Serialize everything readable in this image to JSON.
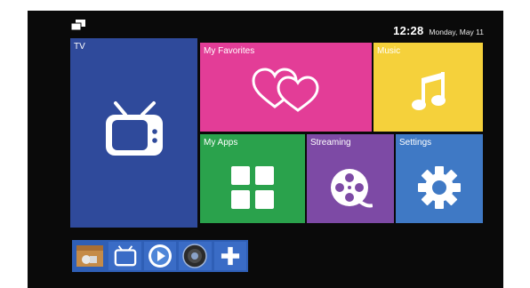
{
  "status": {
    "time": "12:28",
    "date": "Monday, May 11"
  },
  "tiles": {
    "tv": {
      "label": "TV",
      "color": "#2f4a9b",
      "icon": "tv-icon"
    },
    "favorites": {
      "label": "My Favorites",
      "color": "#e33d97",
      "icon": "hearts-icon"
    },
    "music": {
      "label": "Music",
      "color": "#f5d13b",
      "icon": "music-note-icon"
    },
    "apps": {
      "label": "My Apps",
      "color": "#2aa24c",
      "icon": "grid-icon"
    },
    "streaming": {
      "label": "Streaming",
      "color": "#7d4aa5",
      "icon": "film-reel-icon"
    },
    "settings": {
      "label": "Settings",
      "color": "#3f79c5",
      "icon": "gear-icon"
    }
  },
  "dock": {
    "items": [
      {
        "icon": "file-manager-icon"
      },
      {
        "icon": "tv-icon"
      },
      {
        "icon": "play-icon"
      },
      {
        "icon": "speaker-icon"
      },
      {
        "icon": "plus-icon"
      }
    ]
  }
}
